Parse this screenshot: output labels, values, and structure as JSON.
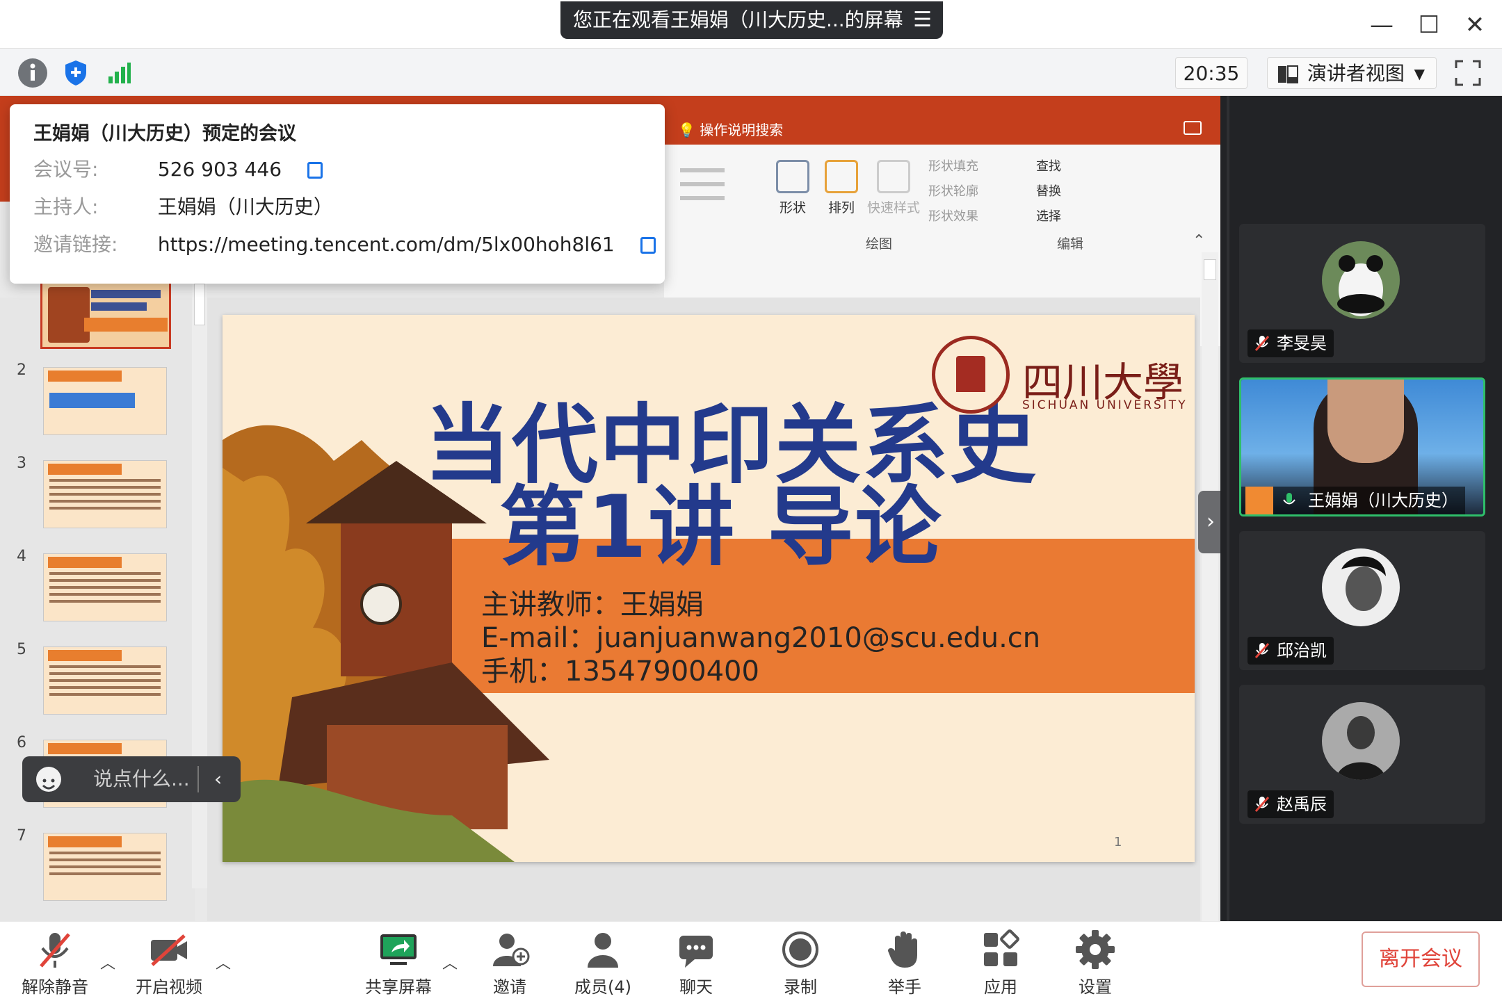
{
  "title_bar": {
    "share_notice": "您正在观看王娟娟（川大历史...的屏幕",
    "menu_glyph": "☰",
    "minimize": "—",
    "maximize": "☐",
    "close": "✕"
  },
  "toolbar": {
    "time": "20:35",
    "view_mode": "演讲者视图",
    "icons": [
      "info-icon",
      "shield-icon",
      "signal-icon",
      "fullscreen-icon"
    ]
  },
  "meeting_info": {
    "title": "王娟娟（川大历史）预定的会议",
    "rows": [
      {
        "key": "会议号:",
        "value": "526 903 446"
      },
      {
        "key": "主持人:",
        "value": "王娟娟（川大历史）"
      },
      {
        "key": "邀请链接:",
        "value": "https://meeting.tencent.com/dm/5lx00hoh8l61"
      }
    ]
  },
  "powerpoint": {
    "tell_me": "操作说明搜索",
    "ribbon": {
      "shape": "形状",
      "arrange": "排列",
      "quick_style": "快速样式",
      "shape_fill": "形状填充",
      "shape_outline": "形状轮廓",
      "shape_effect": "形状效果",
      "find": "查找",
      "replace": "替换",
      "select": "选择",
      "group_drawing": "绘图",
      "group_edit": "编辑"
    },
    "slide_numbers": [
      "2",
      "3",
      "4",
      "5",
      "6",
      "7"
    ],
    "slide": {
      "title_line1": "当代中印关系史",
      "title_line2": "第1讲 导论",
      "teacher": "主讲教师：王娟娟",
      "email": "E-mail：juanjuanwang2010@scu.edu.cn",
      "phone": "手机：13547900400",
      "university_cn": "四川大學",
      "university_en": "SICHUAN UNIVERSITY",
      "page_number": "1"
    }
  },
  "chat": {
    "placeholder": "说点什么..."
  },
  "participants": [
    {
      "name": "李旻昊",
      "muted": true
    },
    {
      "name": "王娟娟（川大历史）",
      "muted": false,
      "active": true
    },
    {
      "name": "邱治凯",
      "muted": true
    },
    {
      "name": "赵禹辰",
      "muted": true
    }
  ],
  "bottom_bar": {
    "unmute": "解除静音",
    "start_video": "开启视频",
    "share_screen": "共享屏幕",
    "invite": "邀请",
    "members": "成员(4)",
    "chat": "聊天",
    "record": "录制",
    "raise_hand": "举手",
    "apps": "应用",
    "settings": "设置",
    "leave": "离开会议"
  },
  "colors": {
    "ppt_red": "#c43e1c",
    "slide_title_blue": "#233a8c",
    "slide_band_orange": "#ea7a33",
    "active_speaker_green": "#2fbf6a",
    "leave_red": "#e0443a",
    "tencent_blue": "#1a73e8"
  }
}
